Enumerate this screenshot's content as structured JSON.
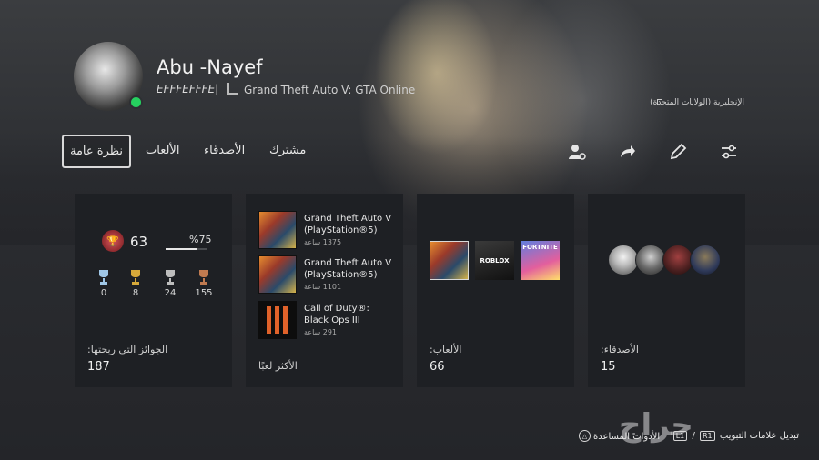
{
  "profile": {
    "username": "Abu -Nayef",
    "online_id": "EFFFEFFFE",
    "separator": "|",
    "now_playing": "Grand Theft Auto V: GTA Online",
    "region": "الإنجليزية (الولايات المتحدة)",
    "status_color": "#26d05f"
  },
  "tabs": {
    "overview": "نظرة عامة",
    "games": "الألعاب",
    "friends": "الأصدقاء",
    "subscribe": "مشترك"
  },
  "actions": [
    "add-friend-icon",
    "share-icon",
    "edit-icon",
    "settings-icon"
  ],
  "trophies": {
    "level": "63",
    "progress_text": "%75",
    "progress": 0.75,
    "counts": {
      "platinum": "0",
      "gold": "8",
      "silver": "24",
      "bronze": "155"
    },
    "label": "الجوائز التي ربحتها:",
    "total": "187"
  },
  "most_played": {
    "label": "الأكثر لعبًا",
    "games": [
      {
        "title": "Grand Theft Auto V (PlayStation®5)",
        "hours": "1375 ساعة"
      },
      {
        "title": "Grand Theft Auto V (PlayStation®5)",
        "hours": "1101 ساعة"
      },
      {
        "title": "Call of Duty®: Black Ops III",
        "hours": "291 ساعة"
      }
    ]
  },
  "games": {
    "label": "الألعاب:",
    "count": "66",
    "thumbs": {
      "roblox": "ROBLOX",
      "fortnite": "FORTNITE"
    }
  },
  "friends": {
    "label": "الأصدقاء:",
    "count": "15"
  },
  "footer": {
    "switch_tabs": "تبديل علامات التبويب",
    "r1": "R1",
    "slash": "/",
    "l1": "L1",
    "tools": "الأدوات المساعدة",
    "triangle": "△"
  },
  "watermark": "حراج"
}
